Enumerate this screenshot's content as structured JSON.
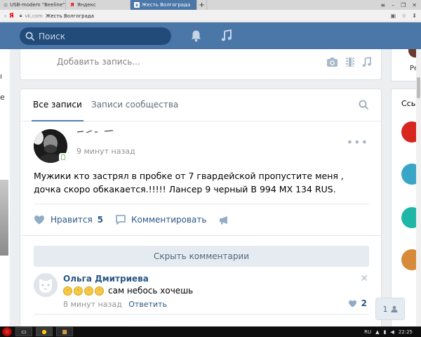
{
  "browser": {
    "tabs": [
      {
        "label": "USB-modem \"Beeline\""
      },
      {
        "label": "Яндекс"
      },
      {
        "label": "Жесть Волгограда",
        "active": true
      }
    ],
    "new_tab": "+",
    "address": {
      "ya": "Я",
      "domain": "vk.com",
      "title": "Жесть Волгограда"
    }
  },
  "header": {
    "search_placeholder": "Поиск",
    "bell_icon": "bell-icon",
    "music_icon": "music-icon",
    "accent": "#4a76a8"
  },
  "add_post": {
    "placeholder": "Добавить запись..."
  },
  "feed": {
    "tabs": [
      {
        "label": "Все записи",
        "active": true
      },
      {
        "label": "Записи сообщества"
      }
    ],
    "post": {
      "time": "9 минут назад",
      "text": "Мужики кто застрял в пробке от 7 гвардейской пропустите меня , дочка скоро обкакается.!!!!! Лансер 9 черный В 994 МХ 134 RUS.",
      "actions": {
        "like_label": "Нравится",
        "like_count": "5",
        "comment_label": "Комментировать"
      }
    },
    "hide_comments": "Скрыть комментарии",
    "comment": {
      "author": "Ольга Дмитриева",
      "text": "сам небось хочешь",
      "emoji_count": 4,
      "time": "8 минут назад",
      "reply": "Ответить",
      "likes": "2"
    }
  },
  "right_sidebar": {
    "top_label": "Ре",
    "header": "Ссь"
  },
  "chat_widget": {
    "count": "1"
  },
  "taskbar": {
    "lang": "RU",
    "clock": "22:25"
  }
}
